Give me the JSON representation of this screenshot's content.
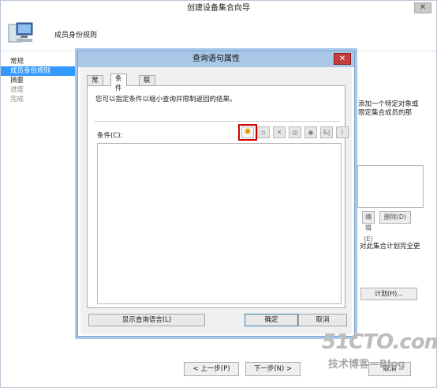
{
  "wizard": {
    "title": "创建设备集合向导",
    "header_title": "成员身份规则",
    "close_glyph": "✕",
    "steps": [
      {
        "label": "常规",
        "state": "normal"
      },
      {
        "label": "成员身份规则",
        "state": "selected"
      },
      {
        "label": "摘要",
        "state": "normal"
      },
      {
        "label": "进度",
        "state": "disabled"
      },
      {
        "label": "完成",
        "state": "disabled"
      }
    ],
    "bg_text_1": "添加一个特定对象或",
    "bg_text_2": "限定集合成员的那",
    "bg_text_3": "对此集合计划完全更",
    "bg_btn_edit": "编辑(E)",
    "bg_btn_delete": "删除(D)",
    "schedule_button": "计划(H)...",
    "back_button": "< 上一步(P)",
    "next_button": "下一步(N) >",
    "cancel_button": "取消"
  },
  "dialog": {
    "title": "查询语句属性",
    "close_glyph": "✕",
    "tabs": [
      {
        "label": "常规",
        "active": false
      },
      {
        "label": "条件",
        "active": true
      },
      {
        "label": "联接",
        "active": false
      }
    ],
    "description": "您可以指定条件以缩小查询并限制返回的结果。",
    "criteria_label": "条件(C):",
    "toolbar": [
      {
        "icon": "new-criterion-icon",
        "glyph": "✹",
        "highlighted": true
      },
      {
        "icon": "properties-icon",
        "glyph": "▫"
      },
      {
        "icon": "delete-icon",
        "glyph": "✕"
      },
      {
        "icon": "group-icon",
        "glyph": "◎"
      },
      {
        "icon": "ungroup-icon",
        "glyph": "◉"
      },
      {
        "icon": "and-or-icon",
        "glyph": "&|"
      },
      {
        "icon": "not-icon",
        "glyph": "!"
      }
    ],
    "show_query_button": "显示查询语言(L)",
    "ok_button": "确定",
    "cancel_button": "取消"
  },
  "watermark": {
    "main": "51CTO.com",
    "sub": "技术博客—Blog"
  },
  "colors": {
    "selection": "#3399ff",
    "dialog_frame": "#a9c8e8",
    "close_red": "#c43c3c",
    "highlight_red": "#d00000",
    "add_star": "#e09b00"
  }
}
